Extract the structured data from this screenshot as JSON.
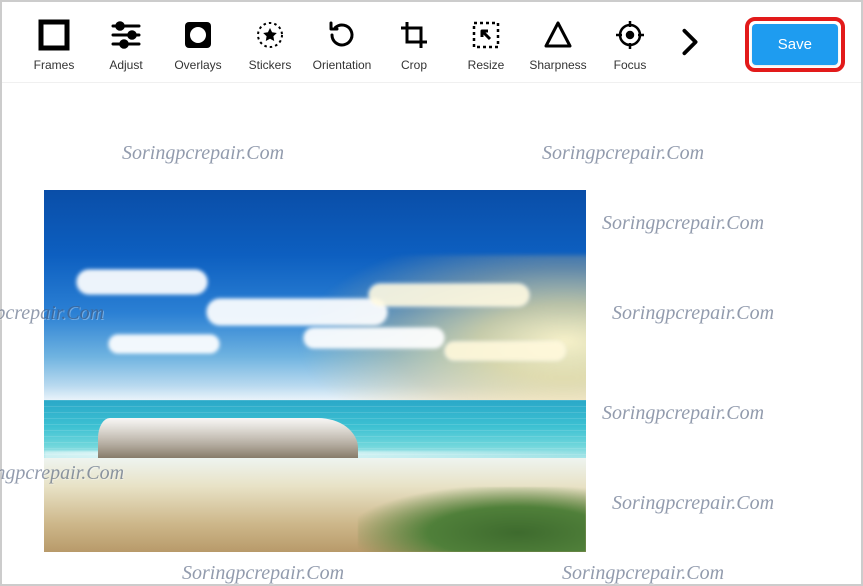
{
  "toolbar": {
    "items": [
      {
        "id": "frames",
        "label": "Frames"
      },
      {
        "id": "adjust",
        "label": "Adjust"
      },
      {
        "id": "overlays",
        "label": "Overlays"
      },
      {
        "id": "stickers",
        "label": "Stickers"
      },
      {
        "id": "orientation",
        "label": "Orientation"
      },
      {
        "id": "crop",
        "label": "Crop"
      },
      {
        "id": "resize",
        "label": "Resize"
      },
      {
        "id": "sharpness",
        "label": "Sharpness"
      },
      {
        "id": "focus",
        "label": "Focus"
      }
    ],
    "save_label": "Save"
  },
  "watermark_text": "Soringpcrepair.Com",
  "colors": {
    "accent": "#1e9cf0",
    "highlight_border": "#e21a1a"
  }
}
